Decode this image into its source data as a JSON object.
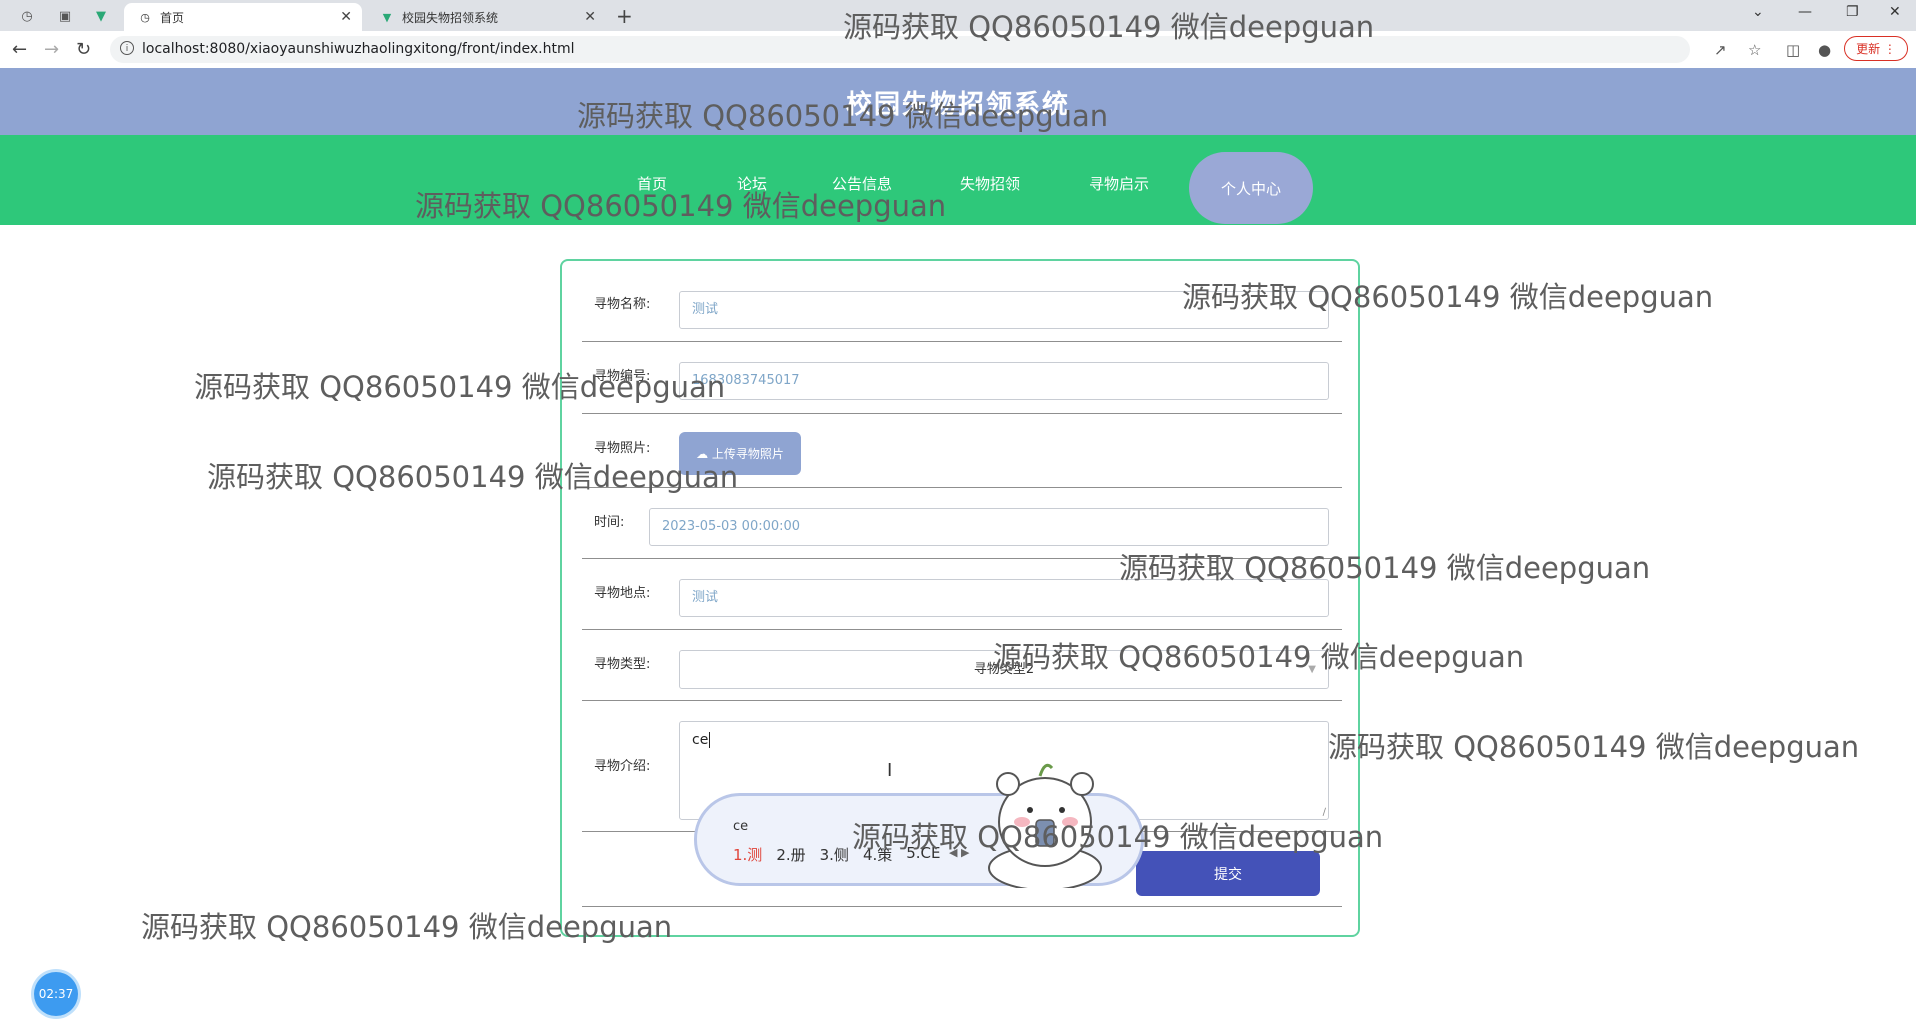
{
  "browser": {
    "tabs": [
      {
        "title": "首页",
        "active": true
      },
      {
        "title": "校园失物招领系统",
        "active": false
      }
    ],
    "url": "localhost:8080/xiaoyaunshiwuzhaolingxitong/front/index.html",
    "update_label": "更新"
  },
  "site": {
    "title": "校园失物招领系统",
    "nav": [
      "首页",
      "论坛",
      "公告信息",
      "失物招领",
      "寻物启示",
      "个人中心"
    ],
    "active_nav": "个人中心"
  },
  "form": {
    "name_label": "寻物名称:",
    "name_value": "测试",
    "number_label": "寻物编号:",
    "number_value": "1683083745017",
    "photo_label": "寻物照片:",
    "upload_label": "上传寻物照片",
    "time_label": "时间:",
    "time_value": "2023-05-03 00:00:00",
    "place_label": "寻物地点:",
    "place_value": "测试",
    "type_label": "寻物类型:",
    "type_value": "寻物类型2",
    "intro_label": "寻物介绍:",
    "intro_value": "ce",
    "submit_label": "提交"
  },
  "ime": {
    "typed": "ce",
    "candidates": [
      "1.测",
      "2.册",
      "3.侧",
      "4.策",
      "5.CE"
    ]
  },
  "timer": "02:37",
  "watermark": "源码获取 QQ86050149 微信deepguan"
}
